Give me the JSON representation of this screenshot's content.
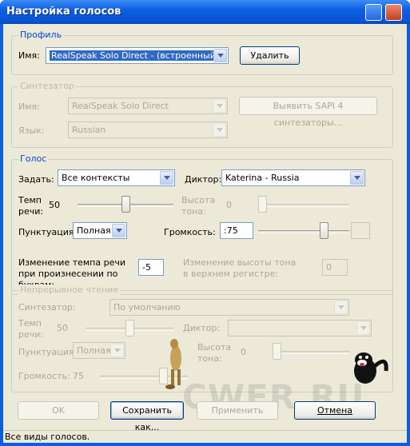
{
  "window": {
    "title": "Настройка голосов"
  },
  "profile": {
    "legend": "Профиль",
    "name_label": "Имя:",
    "name_value": "RealSpeak Solo Direct - (встроенный)",
    "delete_label": "Удалить"
  },
  "synth": {
    "legend": "Синтезатор",
    "name_label": "Имя:",
    "name_value": "RealSpeak Solo Direct",
    "detect_label": "Выявить SAPI 4 синтезаторы...",
    "lang_label": "Язык:",
    "lang_value": "Russian"
  },
  "voice": {
    "legend": "Голос",
    "set_label": "Задать:",
    "set_value": "Все контексты",
    "speaker_label": "Диктор:",
    "speaker_value": "Katerina - Russia",
    "rate_label": "Темп речи:",
    "rate_value": "50",
    "rate_level": 50,
    "pitch_label": "Высота тона:",
    "pitch_value": "0",
    "pitch_level": 0,
    "punct_label": "Пунктуация:",
    "punct_value": "Полная",
    "volume_label": "Громкость:",
    "volume_value": ":75",
    "volume_level": 75,
    "spell_rate_label": "Изменение темпа речи при произнесении по буквам:",
    "spell_rate_value": "-5",
    "upper_pitch_label": "Изменение высоты тона в верхнем регистре:",
    "upper_pitch_value": "0"
  },
  "continuous": {
    "legend": "Непрерывное чтение",
    "synth_label": "Синтезатор:",
    "synth_value": "По умолчанию",
    "rate_label": "Темп речи:",
    "rate_value": "50",
    "rate_level": 50,
    "speaker_label": "Диктор:",
    "speaker_value": "",
    "punct_label": "Пунктуация:",
    "punct_value": "Полная",
    "pitch_label": "Высота тона:",
    "pitch_value": "0",
    "pitch_level": 0,
    "volume_label": "Громкость:",
    "volume_value": "75",
    "volume_level": 75
  },
  "buttons": {
    "ok": "OK",
    "save_as": "Сохранить как...",
    "apply": "Применить",
    "cancel": "Отмена"
  },
  "status": {
    "text": "Все виды голосов."
  },
  "watermark": "CWER.RU"
}
